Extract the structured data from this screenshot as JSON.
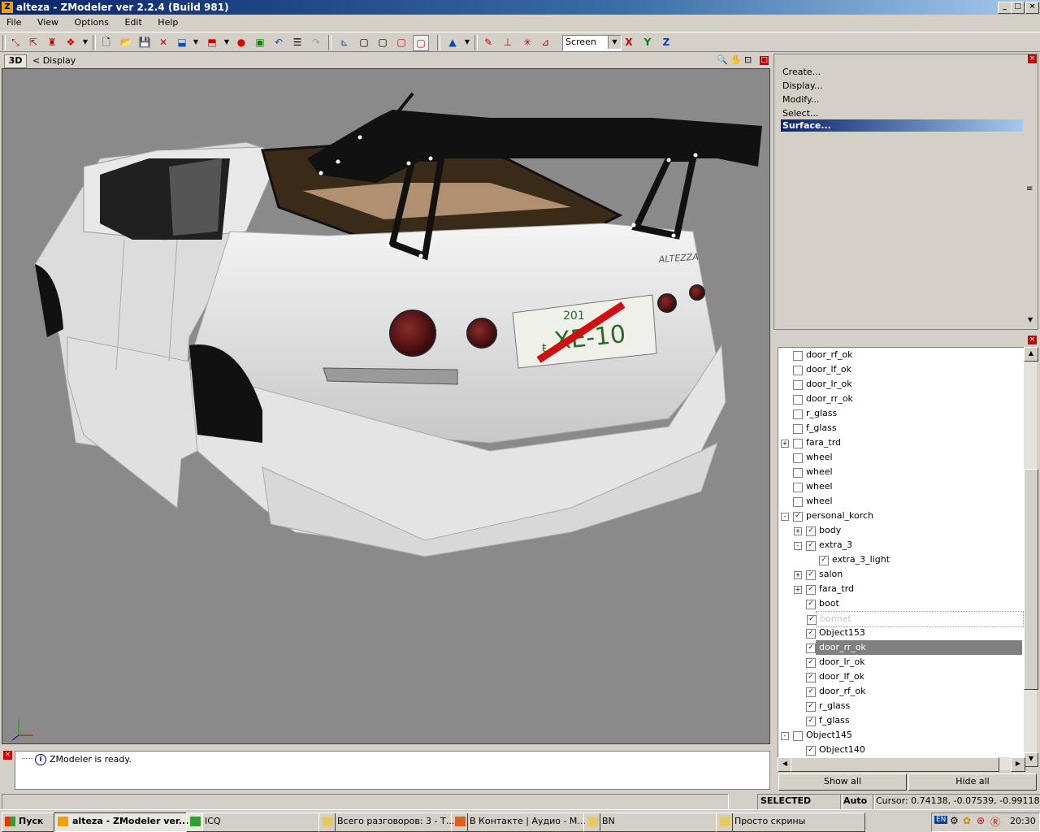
{
  "window": {
    "title": "alteza - ZModeler ver 2.2.4 (Build 981)",
    "app_icon": "Z",
    "controls": [
      "_",
      "□",
      "×"
    ]
  },
  "menu": [
    "File",
    "View",
    "Options",
    "Edit",
    "Help"
  ],
  "toolbar": {
    "coord_mode": "Screen",
    "axis_x": "X",
    "axis_y": "Y",
    "axis_z": "Z"
  },
  "viewport": {
    "mode": "3D",
    "label": "< Display",
    "plate_text": "XE-10",
    "plate_small": "201",
    "plate_prefix": "ŧ",
    "badge_text": "ALTEZZA"
  },
  "command_panel": {
    "items": [
      "Create...",
      "Display...",
      "Modify...",
      "Select...",
      "Surface..."
    ],
    "selected_index": 4
  },
  "tree": [
    {
      "label": "door_rf_ok",
      "checked": false,
      "level": 0,
      "expander": ""
    },
    {
      "label": "door_lf_ok",
      "checked": false,
      "level": 0,
      "expander": ""
    },
    {
      "label": "door_lr_ok",
      "checked": false,
      "level": 0,
      "expander": ""
    },
    {
      "label": "door_rr_ok",
      "checked": false,
      "level": 0,
      "expander": ""
    },
    {
      "label": "r_glass",
      "checked": false,
      "level": 0,
      "expander": ""
    },
    {
      "label": "f_glass",
      "checked": false,
      "level": 0,
      "expander": ""
    },
    {
      "label": "fara_trd",
      "checked": false,
      "level": 0,
      "expander": "+"
    },
    {
      "label": "wheel",
      "checked": false,
      "level": 0,
      "expander": ""
    },
    {
      "label": "wheel",
      "checked": false,
      "level": 0,
      "expander": ""
    },
    {
      "label": "wheel",
      "checked": false,
      "level": 0,
      "expander": ""
    },
    {
      "label": "wheel",
      "checked": false,
      "level": 0,
      "expander": ""
    },
    {
      "label": "personal_korch",
      "checked": true,
      "level": 0,
      "expander": "-"
    },
    {
      "label": "body",
      "checked": true,
      "level": 1,
      "expander": "+"
    },
    {
      "label": "extra_3",
      "checked": true,
      "level": 1,
      "expander": "-"
    },
    {
      "label": "extra_3_light",
      "checked": true,
      "level": 2,
      "expander": ""
    },
    {
      "label": "salon",
      "checked": true,
      "level": 1,
      "expander": "+"
    },
    {
      "label": "fara_trd",
      "checked": true,
      "level": 1,
      "expander": "+"
    },
    {
      "label": "boot",
      "checked": true,
      "level": 1,
      "expander": ""
    },
    {
      "label": "bonnet",
      "checked": true,
      "level": 1,
      "expander": "",
      "state": "dim"
    },
    {
      "label": "Object153",
      "checked": true,
      "level": 1,
      "expander": ""
    },
    {
      "label": "door_rr_ok",
      "checked": true,
      "level": 1,
      "expander": "",
      "state": "selected"
    },
    {
      "label": "door_lr_ok",
      "checked": true,
      "level": 1,
      "expander": ""
    },
    {
      "label": "door_lf_ok",
      "checked": true,
      "level": 1,
      "expander": ""
    },
    {
      "label": "door_rf_ok",
      "checked": true,
      "level": 1,
      "expander": ""
    },
    {
      "label": "r_glass",
      "checked": true,
      "level": 1,
      "expander": ""
    },
    {
      "label": "f_glass",
      "checked": true,
      "level": 1,
      "expander": ""
    },
    {
      "label": "Object145",
      "checked": false,
      "level": 0,
      "expander": "-"
    },
    {
      "label": "Object140",
      "checked": true,
      "level": 1,
      "expander": ""
    }
  ],
  "tree_buttons": {
    "show_all": "Show all",
    "hide_all": "Hide all"
  },
  "log": {
    "message": "ZModeler is ready."
  },
  "status": {
    "mode": "SELECTED MODE",
    "auto": "Auto",
    "cursor": "Cursor: 0.74138, -0.07539, -0.99118"
  },
  "taskbar": {
    "start": "Пуск",
    "tasks": [
      {
        "label": "alteza - ZModeler ver...",
        "active": true,
        "icon_color": "#f0a000"
      },
      {
        "label": "ICQ",
        "active": false,
        "icon_color": "#30a030"
      },
      {
        "label": "Всего разговоров: 3 - Т...",
        "active": false,
        "icon_color": "#e8c860"
      },
      {
        "label": "В Контакте | Аудио - М...",
        "active": false,
        "icon_color": "#e06020"
      },
      {
        "label": "BN",
        "active": false,
        "icon_color": "#e8c860"
      },
      {
        "label": "Просто скрины",
        "active": false,
        "icon_color": "#e8c860"
      }
    ],
    "lang": "EN",
    "clock": "20:30"
  },
  "colors": {
    "title_blue": "#0a246a",
    "viewport_bg": "#8a8a8a",
    "car_body": "#e6e6e6",
    "taillight": "#6a1414",
    "wing": "#111111"
  }
}
